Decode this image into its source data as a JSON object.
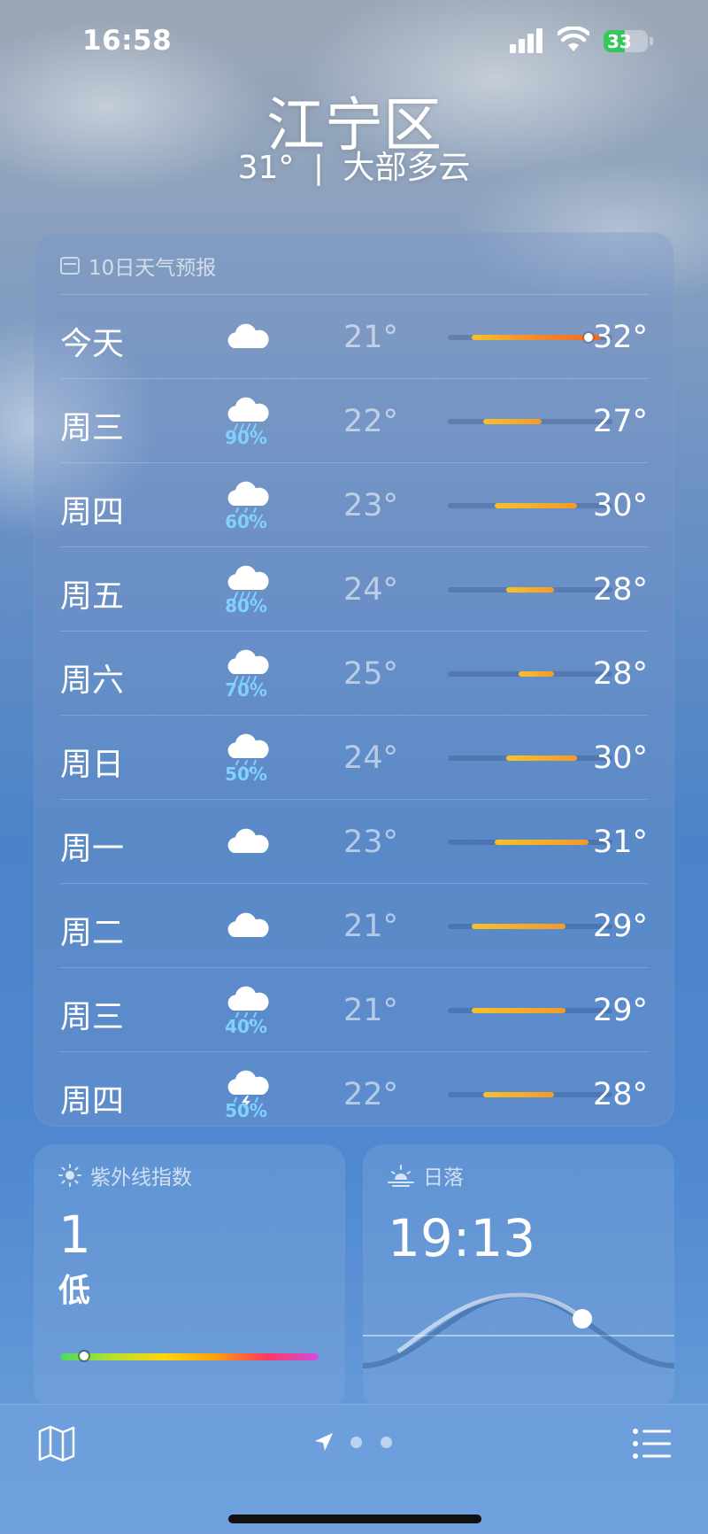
{
  "status_bar": {
    "time": "16:58",
    "battery": "33"
  },
  "header": {
    "city": "江宁区",
    "temperature": "31°",
    "separator": "|",
    "condition": "大部多云"
  },
  "forecast": {
    "title": "10日天气预报",
    "days": [
      {
        "day": "今天",
        "icon": "cloud-icon",
        "precip": "",
        "low": "21°",
        "high": "32°",
        "range_low": 21,
        "range_high": 32,
        "current": 31
      },
      {
        "day": "周三",
        "icon": "cloud-rain-icon",
        "precip": "90%",
        "low": "22°",
        "high": "27°",
        "range_low": 22,
        "range_high": 27
      },
      {
        "day": "周四",
        "icon": "cloud-drizzle-icon",
        "precip": "60%",
        "low": "23°",
        "high": "30°",
        "range_low": 23,
        "range_high": 30
      },
      {
        "day": "周五",
        "icon": "cloud-rain-icon",
        "precip": "80%",
        "low": "24°",
        "high": "28°",
        "range_low": 24,
        "range_high": 28
      },
      {
        "day": "周六",
        "icon": "cloud-rain-icon",
        "precip": "70%",
        "low": "25°",
        "high": "28°",
        "range_low": 25,
        "range_high": 28
      },
      {
        "day": "周日",
        "icon": "cloud-drizzle-icon",
        "precip": "50%",
        "low": "24°",
        "high": "30°",
        "range_low": 24,
        "range_high": 30
      },
      {
        "day": "周一",
        "icon": "cloud-icon",
        "precip": "",
        "low": "23°",
        "high": "31°",
        "range_low": 23,
        "range_high": 31
      },
      {
        "day": "周二",
        "icon": "cloud-icon",
        "precip": "",
        "low": "21°",
        "high": "29°",
        "range_low": 21,
        "range_high": 29
      },
      {
        "day": "周三",
        "icon": "cloud-drizzle-icon",
        "precip": "40%",
        "low": "21°",
        "high": "29°",
        "range_low": 21,
        "range_high": 29
      },
      {
        "day": "周四",
        "icon": "cloud-bolt-icon",
        "precip": "50%",
        "low": "22°",
        "high": "28°",
        "range_low": 22,
        "range_high": 28
      }
    ],
    "scale_min": 19,
    "scale_max": 33
  },
  "uv": {
    "title": "紫外线指数",
    "value": "1",
    "level": "低",
    "index": 1
  },
  "sunset": {
    "title": "日落",
    "time": "19:13"
  },
  "bottom_bar": {
    "map_icon": "map-icon",
    "location_icon": "location-arrow-icon",
    "pages": 3,
    "list_icon": "list-icon"
  },
  "colors": {
    "temp_bar_start": "#f6c12a",
    "temp_bar_end": "#ef6a2a",
    "precip": "#7fd1ff",
    "battery": "#35c759"
  }
}
